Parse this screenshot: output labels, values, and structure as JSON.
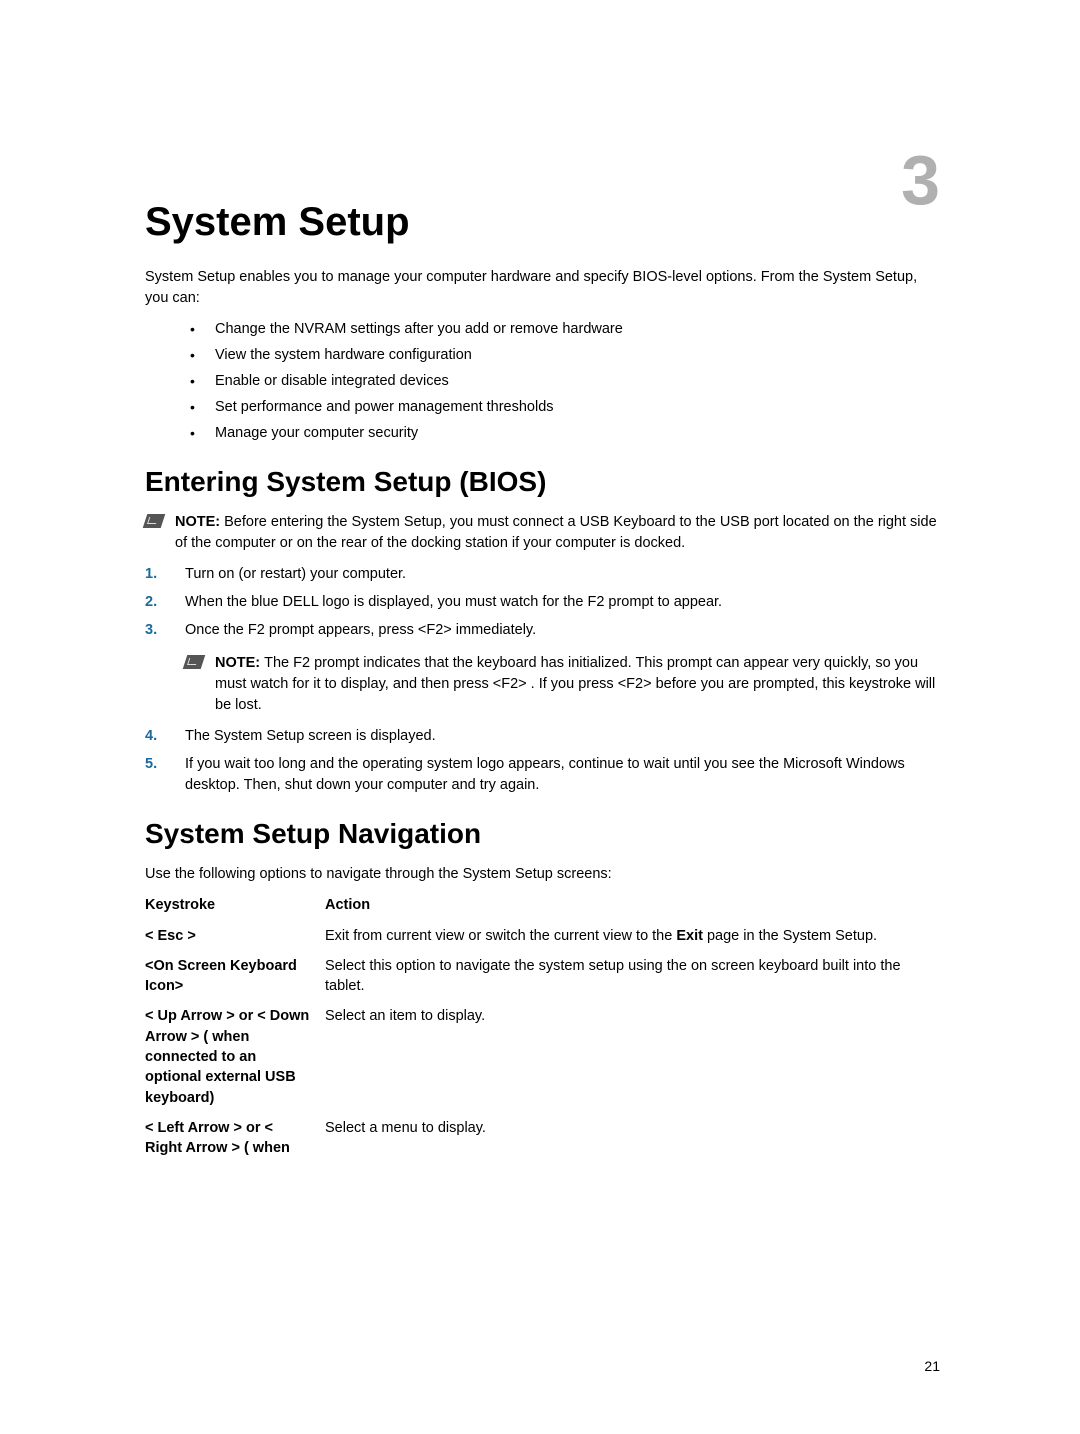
{
  "chapter_number": "3",
  "title": "System Setup",
  "intro": "System Setup enables you to manage your computer hardware and specify BIOS-level options. From the System Setup, you can:",
  "bullets": [
    "Change the NVRAM settings after you add or remove hardware",
    "View the system hardware configuration",
    "Enable or disable integrated devices",
    "Set performance and power management thresholds",
    "Manage your computer security"
  ],
  "section1": {
    "heading": "Entering System Setup (BIOS)",
    "note_label": "NOTE: ",
    "note1": "Before entering the System Setup, you must connect a USB Keyboard to the USB port located on the right side of the computer or on the rear of the docking station if your computer is docked.",
    "steps": [
      {
        "n": "1.",
        "t": "Turn on (or restart) your computer."
      },
      {
        "n": "2.",
        "t": "When the blue DELL logo is displayed, you must watch for the F2 prompt to appear."
      },
      {
        "n": "3.",
        "t": "Once the F2 prompt appears, press <F2> immediately."
      }
    ],
    "note2_label": "NOTE: ",
    "note2": "The F2 prompt indicates that the keyboard has initialized. This prompt can appear very quickly, so you must watch for it to display, and then press <F2> . If you press <F2> before you are prompted, this keystroke will be lost.",
    "steps_after": [
      {
        "n": "4.",
        "t": "The System Setup screen is displayed."
      },
      {
        "n": "5.",
        "t": "If you wait too long and the operating system logo appears, continue to wait until you see the Microsoft Windows desktop. Then, shut down your computer and try again."
      }
    ]
  },
  "section2": {
    "heading": "System Setup Navigation",
    "intro": "Use the following options to navigate through the System Setup screens:",
    "header": {
      "key": "Keystroke",
      "action": "Action"
    },
    "rows": [
      {
        "key": "< Esc >",
        "action_pre": "Exit from current view or switch the current view to the ",
        "action_bold": "Exit",
        "action_post": " page in the System Setup."
      },
      {
        "key": "<On Screen Keyboard Icon>",
        "action": "Select this option to navigate the system setup using the on screen keyboard built into the tablet."
      },
      {
        "key": "< Up Arrow > or < Down Arrow > ( when connected to an optional external USB keyboard)",
        "action": "Select an item to display."
      },
      {
        "key": "< Left Arrow > or < Right Arrow > ( when",
        "action": "Select a menu to display."
      }
    ]
  },
  "page_number": "21"
}
